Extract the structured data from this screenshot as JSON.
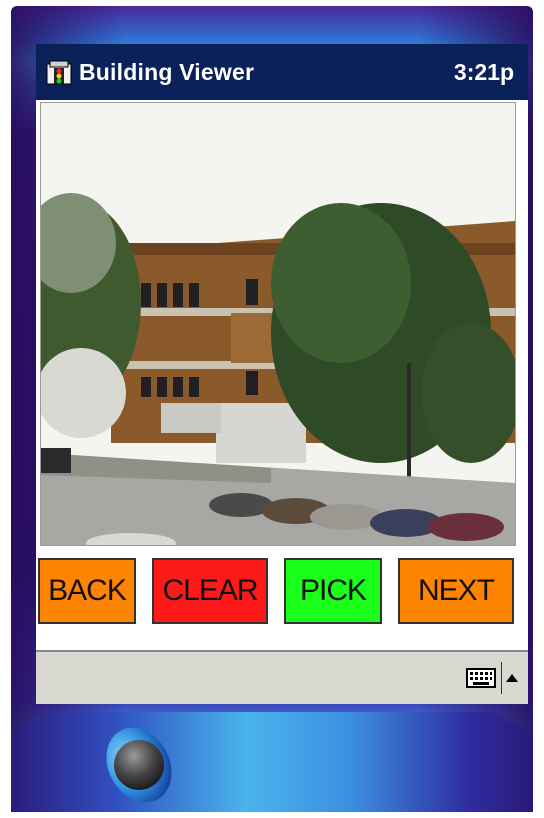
{
  "titlebar": {
    "app_title": "Building Viewer",
    "clock": "3:21p",
    "app_icon": "building-viewer-app-icon"
  },
  "photo": {
    "subject": "building-photo"
  },
  "buttons": [
    {
      "label": "BACK",
      "color": "#ff8400"
    },
    {
      "label": "CLEAR",
      "color": "#ff1a1a"
    },
    {
      "label": "PICK",
      "color": "#1aff1a"
    },
    {
      "label": "NEXT",
      "color": "#ff8400"
    }
  ],
  "command_bar": {
    "keyboard_icon": "keyboard-icon",
    "sip_arrow_icon": "up-arrow-icon"
  },
  "colors": {
    "titlebar_bg": "#0b2159",
    "command_bar_bg": "#d8d8d0"
  }
}
